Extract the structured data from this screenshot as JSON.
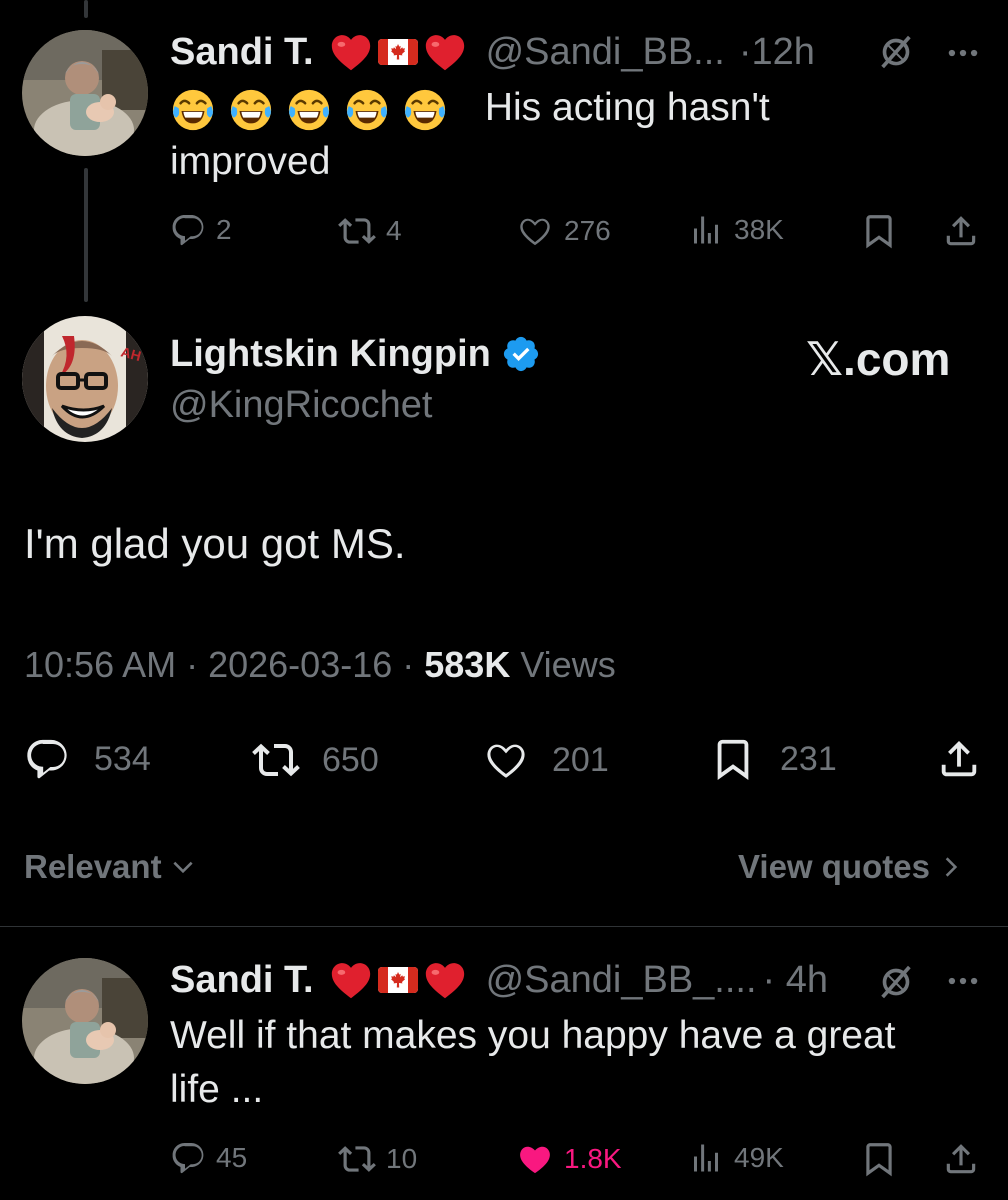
{
  "tweet1": {
    "name": "Sandi T.",
    "handle": "@Sandi_BB...",
    "time": "·12h",
    "text_line1": "His acting hasn't",
    "text_line2": "improved",
    "emoji_count": 5,
    "replies": "2",
    "retweets": "4",
    "likes": "276",
    "views": "38K"
  },
  "main": {
    "name": "Lightskin Kingpin",
    "handle": "@KingRicochet",
    "watermark": "𝕏.com",
    "text": "I'm glad you got MS.",
    "time": "10:56 AM · 2026-03-16 · ",
    "views_count": "583K",
    "views_label": " Views",
    "replies": "534",
    "retweets": "650",
    "likes": "201",
    "bookmarks": "231"
  },
  "sort": {
    "relevant": "Relevant",
    "view_quotes": "View quotes"
  },
  "tweet2": {
    "name": "Sandi T.",
    "handle": "@Sandi_BB_....",
    "time": "· 4h",
    "text_line1": "Well if that makes you happy have a great",
    "text_line2": "life ...",
    "replies": "45",
    "retweets": "10",
    "likes": "1.8K",
    "views": "49K"
  },
  "colors": {
    "background": "#000000",
    "text": "#e7e9ea",
    "muted": "#71767b",
    "like_active": "#f91880",
    "verified": "#1d9bf0",
    "heart_emoji": "#e0202e"
  },
  "icons": [
    "reply-icon",
    "retweet-icon",
    "like-icon",
    "views-icon",
    "bookmark-icon",
    "share-icon",
    "grok-icon",
    "more-icon",
    "verified-icon",
    "chevron-down-icon",
    "chevron-right-icon"
  ]
}
